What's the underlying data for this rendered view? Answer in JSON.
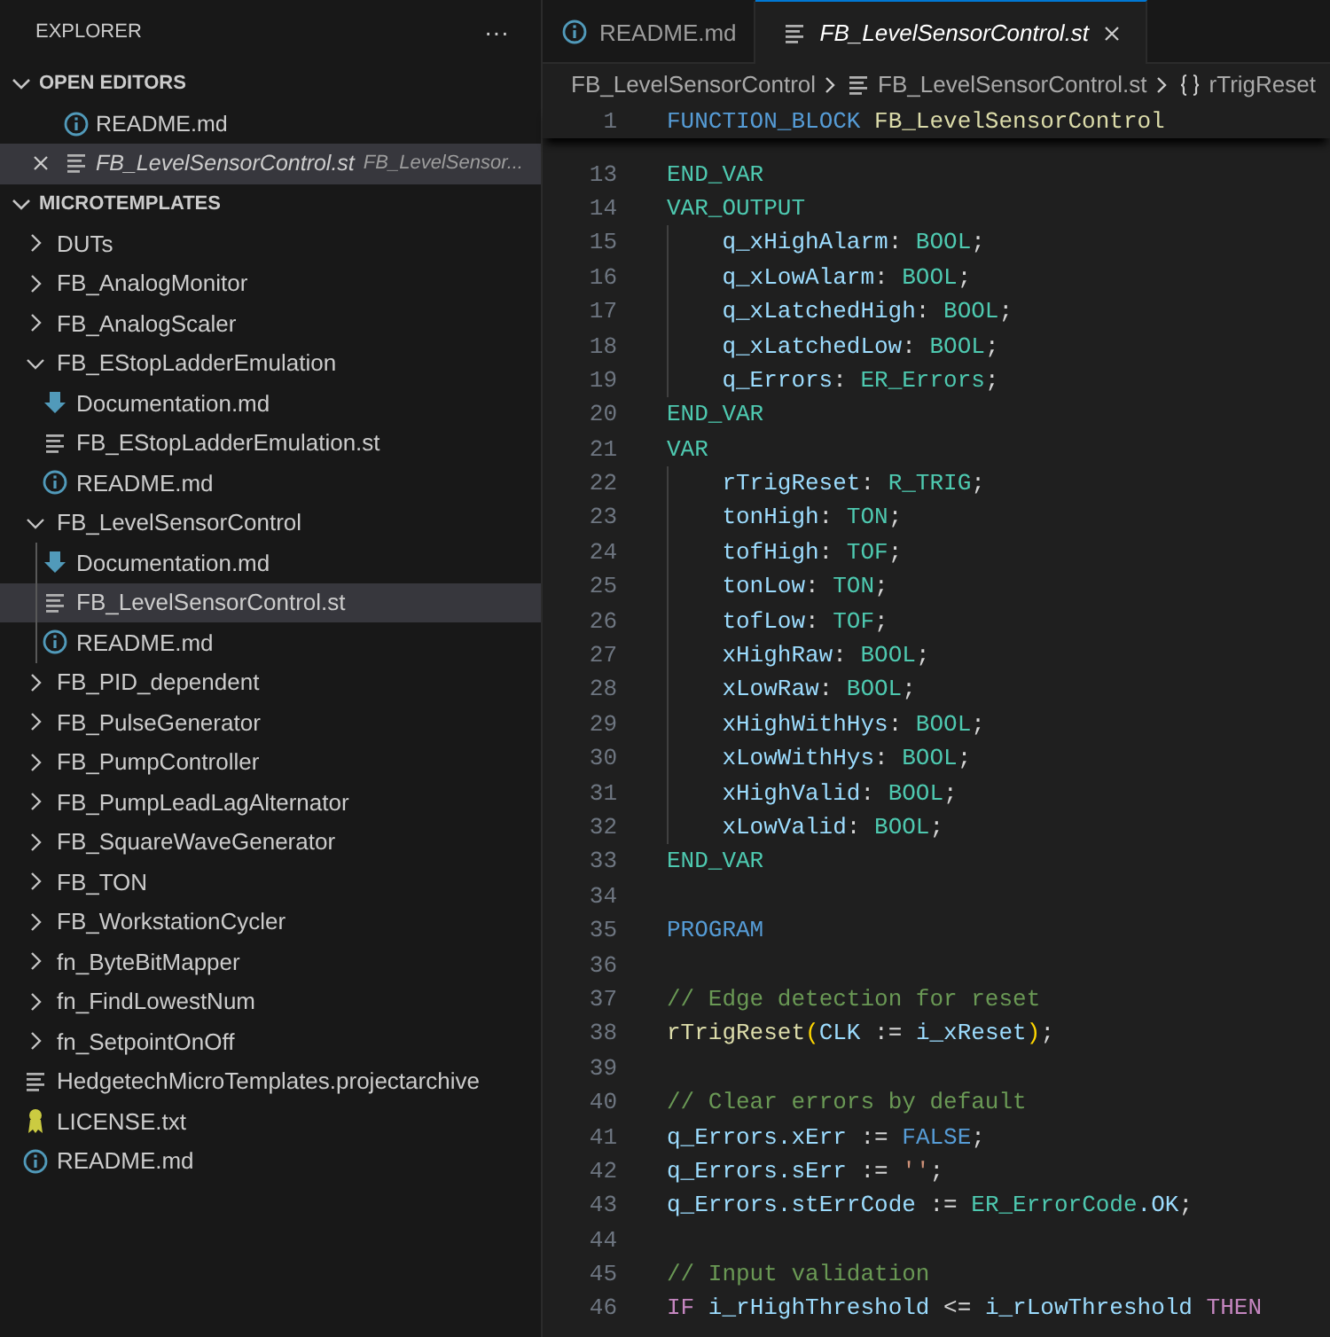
{
  "sidebar": {
    "title": "EXPLORER",
    "more": "···",
    "open_editors": {
      "title": "OPEN EDITORS",
      "expanded": true,
      "items": [
        {
          "label": "README.md",
          "kind": "info",
          "selected": false,
          "preview": false
        },
        {
          "label": "FB_LevelSensorControl.st",
          "kind": "source",
          "description": "FB_LevelSensor...",
          "selected": true,
          "preview": true
        }
      ]
    },
    "project": {
      "title": "MICROTEMPLATES",
      "expanded": true,
      "items": [
        {
          "label": "DUTs",
          "kind": "folder",
          "expanded": false,
          "selected": false
        },
        {
          "label": "FB_AnalogMonitor",
          "kind": "folder",
          "expanded": false,
          "selected": false
        },
        {
          "label": "FB_AnalogScaler",
          "kind": "folder",
          "expanded": false,
          "selected": false
        },
        {
          "label": "FB_EStopLadderEmulation",
          "kind": "folder",
          "expanded": true,
          "selected": false,
          "children": [
            {
              "label": "Documentation.md",
              "kind": "markdown",
              "selected": false
            },
            {
              "label": "FB_EStopLadderEmulation.st",
              "kind": "source",
              "selected": false
            },
            {
              "label": "README.md",
              "kind": "info",
              "selected": false
            }
          ]
        },
        {
          "label": "FB_LevelSensorControl",
          "kind": "folder",
          "expanded": true,
          "selected": false,
          "children": [
            {
              "label": "Documentation.md",
              "kind": "markdown",
              "selected": false
            },
            {
              "label": "FB_LevelSensorControl.st",
              "kind": "source",
              "selected": true
            },
            {
              "label": "README.md",
              "kind": "info",
              "selected": false
            }
          ]
        },
        {
          "label": "FB_PID_dependent",
          "kind": "folder",
          "expanded": false,
          "selected": false
        },
        {
          "label": "FB_PulseGenerator",
          "kind": "folder",
          "expanded": false,
          "selected": false
        },
        {
          "label": "FB_PumpController",
          "kind": "folder",
          "expanded": false,
          "selected": false
        },
        {
          "label": "FB_PumpLeadLagAlternator",
          "kind": "folder",
          "expanded": false,
          "selected": false
        },
        {
          "label": "FB_SquareWaveGenerator",
          "kind": "folder",
          "expanded": false,
          "selected": false
        },
        {
          "label": "FB_TON",
          "kind": "folder",
          "expanded": false,
          "selected": false
        },
        {
          "label": "FB_WorkstationCycler",
          "kind": "folder",
          "expanded": false,
          "selected": false
        },
        {
          "label": "fn_ByteBitMapper",
          "kind": "folder",
          "expanded": false,
          "selected": false
        },
        {
          "label": "fn_FindLowestNum",
          "kind": "folder",
          "expanded": false,
          "selected": false
        },
        {
          "label": "fn_SetpointOnOff",
          "kind": "folder",
          "expanded": false,
          "selected": false
        },
        {
          "label": "HedgetechMicroTemplates.projectarchive",
          "kind": "source",
          "selected": false
        },
        {
          "label": "LICENSE.txt",
          "kind": "license",
          "selected": false
        },
        {
          "label": "README.md",
          "kind": "info",
          "selected": false
        }
      ]
    }
  },
  "tabs": [
    {
      "label": "README.md",
      "kind": "info",
      "selected": false,
      "preview": false
    },
    {
      "label": "FB_LevelSensorControl.st",
      "kind": "source",
      "selected": true,
      "preview": true
    }
  ],
  "breadcrumbs": [
    {
      "label": "FB_LevelSensorControl",
      "kind": "folder"
    },
    {
      "label": "FB_LevelSensorControl.st",
      "kind": "source"
    },
    {
      "label": "rTrigReset",
      "kind": "symbol"
    }
  ],
  "sticky_lines": [
    {
      "number": "1",
      "tokens": [
        {
          "text": "FUNCTION_BLOCK",
          "kind": "keyword"
        },
        {
          "text": " FB_LevelSensorControl",
          "kind": "function"
        }
      ]
    }
  ],
  "code_lines": [
    {
      "number": "13",
      "indented": false,
      "tokens": [
        {
          "text": "END_VAR",
          "kind": "section"
        }
      ]
    },
    {
      "number": "14",
      "indented": false,
      "tokens": [
        {
          "text": "VAR_OUTPUT",
          "kind": "section"
        }
      ]
    },
    {
      "number": "15",
      "indented": true,
      "tokens": [
        {
          "text": "q_xHighAlarm",
          "kind": "variable"
        },
        {
          "text": ": ",
          "kind": "operator"
        },
        {
          "text": "BOOL",
          "kind": "type"
        },
        {
          "text": ";",
          "kind": "operator"
        }
      ]
    },
    {
      "number": "16",
      "indented": true,
      "tokens": [
        {
          "text": "q_xLowAlarm",
          "kind": "variable"
        },
        {
          "text": ": ",
          "kind": "operator"
        },
        {
          "text": "BOOL",
          "kind": "type"
        },
        {
          "text": ";",
          "kind": "operator"
        }
      ]
    },
    {
      "number": "17",
      "indented": true,
      "tokens": [
        {
          "text": "q_xLatchedHigh",
          "kind": "variable"
        },
        {
          "text": ": ",
          "kind": "operator"
        },
        {
          "text": "BOOL",
          "kind": "type"
        },
        {
          "text": ";",
          "kind": "operator"
        }
      ]
    },
    {
      "number": "18",
      "indented": true,
      "tokens": [
        {
          "text": "q_xLatchedLow",
          "kind": "variable"
        },
        {
          "text": ": ",
          "kind": "operator"
        },
        {
          "text": "BOOL",
          "kind": "type"
        },
        {
          "text": ";",
          "kind": "operator"
        }
      ]
    },
    {
      "number": "19",
      "indented": true,
      "tokens": [
        {
          "text": "q_Errors",
          "kind": "variable"
        },
        {
          "text": ": ",
          "kind": "operator"
        },
        {
          "text": "ER_Errors",
          "kind": "type"
        },
        {
          "text": ";",
          "kind": "operator"
        }
      ]
    },
    {
      "number": "20",
      "indented": false,
      "tokens": [
        {
          "text": "END_VAR",
          "kind": "section"
        }
      ]
    },
    {
      "number": "21",
      "indented": false,
      "tokens": [
        {
          "text": "VAR",
          "kind": "section"
        }
      ]
    },
    {
      "number": "22",
      "indented": true,
      "tokens": [
        {
          "text": "rTrigReset",
          "kind": "variable"
        },
        {
          "text": ": ",
          "kind": "operator"
        },
        {
          "text": "R_TRIG",
          "kind": "type"
        },
        {
          "text": ";",
          "kind": "operator"
        }
      ]
    },
    {
      "number": "23",
      "indented": true,
      "tokens": [
        {
          "text": "tonHigh",
          "kind": "variable"
        },
        {
          "text": ": ",
          "kind": "operator"
        },
        {
          "text": "TON",
          "kind": "type"
        },
        {
          "text": ";",
          "kind": "operator"
        }
      ]
    },
    {
      "number": "24",
      "indented": true,
      "tokens": [
        {
          "text": "tofHigh",
          "kind": "variable"
        },
        {
          "text": ": ",
          "kind": "operator"
        },
        {
          "text": "TOF",
          "kind": "type"
        },
        {
          "text": ";",
          "kind": "operator"
        }
      ]
    },
    {
      "number": "25",
      "indented": true,
      "tokens": [
        {
          "text": "tonLow",
          "kind": "variable"
        },
        {
          "text": ": ",
          "kind": "operator"
        },
        {
          "text": "TON",
          "kind": "type"
        },
        {
          "text": ";",
          "kind": "operator"
        }
      ]
    },
    {
      "number": "26",
      "indented": true,
      "tokens": [
        {
          "text": "tofLow",
          "kind": "variable"
        },
        {
          "text": ": ",
          "kind": "operator"
        },
        {
          "text": "TOF",
          "kind": "type"
        },
        {
          "text": ";",
          "kind": "operator"
        }
      ]
    },
    {
      "number": "27",
      "indented": true,
      "tokens": [
        {
          "text": "xHighRaw",
          "kind": "variable"
        },
        {
          "text": ": ",
          "kind": "operator"
        },
        {
          "text": "BOOL",
          "kind": "type"
        },
        {
          "text": ";",
          "kind": "operator"
        }
      ]
    },
    {
      "number": "28",
      "indented": true,
      "tokens": [
        {
          "text": "xLowRaw",
          "kind": "variable"
        },
        {
          "text": ": ",
          "kind": "operator"
        },
        {
          "text": "BOOL",
          "kind": "type"
        },
        {
          "text": ";",
          "kind": "operator"
        }
      ]
    },
    {
      "number": "29",
      "indented": true,
      "tokens": [
        {
          "text": "xHighWithHys",
          "kind": "variable"
        },
        {
          "text": ": ",
          "kind": "operator"
        },
        {
          "text": "BOOL",
          "kind": "type"
        },
        {
          "text": ";",
          "kind": "operator"
        }
      ]
    },
    {
      "number": "30",
      "indented": true,
      "tokens": [
        {
          "text": "xLowWithHys",
          "kind": "variable"
        },
        {
          "text": ": ",
          "kind": "operator"
        },
        {
          "text": "BOOL",
          "kind": "type"
        },
        {
          "text": ";",
          "kind": "operator"
        }
      ]
    },
    {
      "number": "31",
      "indented": true,
      "tokens": [
        {
          "text": "xHighValid",
          "kind": "variable"
        },
        {
          "text": ": ",
          "kind": "operator"
        },
        {
          "text": "BOOL",
          "kind": "type"
        },
        {
          "text": ";",
          "kind": "operator"
        }
      ]
    },
    {
      "number": "32",
      "indented": true,
      "tokens": [
        {
          "text": "xLowValid",
          "kind": "variable"
        },
        {
          "text": ": ",
          "kind": "operator"
        },
        {
          "text": "BOOL",
          "kind": "type"
        },
        {
          "text": ";",
          "kind": "operator"
        }
      ]
    },
    {
      "number": "33",
      "indented": false,
      "tokens": [
        {
          "text": "END_VAR",
          "kind": "section"
        }
      ]
    },
    {
      "number": "34",
      "indented": false
    },
    {
      "number": "35",
      "indented": false,
      "tokens": [
        {
          "text": "PROGRAM",
          "kind": "keyword"
        }
      ]
    },
    {
      "number": "36",
      "indented": false
    },
    {
      "number": "37",
      "indented": false,
      "tokens": [
        {
          "text": "// Edge detection for reset",
          "kind": "comment"
        }
      ]
    },
    {
      "number": "38",
      "indented": false,
      "tokens": [
        {
          "text": "rTrigReset",
          "kind": "function"
        },
        {
          "text": "(",
          "kind": "bracket"
        },
        {
          "text": "CLK",
          "kind": "variable"
        },
        {
          "text": " := ",
          "kind": "operator"
        },
        {
          "text": "i_xReset",
          "kind": "variable"
        },
        {
          "text": ")",
          "kind": "bracket"
        },
        {
          "text": ";",
          "kind": "operator"
        }
      ]
    },
    {
      "number": "39",
      "indented": false
    },
    {
      "number": "40",
      "indented": false,
      "tokens": [
        {
          "text": "// Clear errors by default",
          "kind": "comment"
        }
      ]
    },
    {
      "number": "41",
      "indented": false,
      "tokens": [
        {
          "text": "q_Errors.xErr",
          "kind": "variable"
        },
        {
          "text": " := ",
          "kind": "operator"
        },
        {
          "text": "FALSE",
          "kind": "keyword"
        },
        {
          "text": ";",
          "kind": "operator"
        }
      ]
    },
    {
      "number": "42",
      "indented": false,
      "tokens": [
        {
          "text": "q_Errors.sErr",
          "kind": "variable"
        },
        {
          "text": " := ",
          "kind": "operator"
        },
        {
          "text": "''",
          "kind": "string"
        },
        {
          "text": ";",
          "kind": "operator"
        }
      ]
    },
    {
      "number": "43",
      "indented": false,
      "tokens": [
        {
          "text": "q_Errors.stErrCode",
          "kind": "variable"
        },
        {
          "text": " := ",
          "kind": "operator"
        },
        {
          "text": "ER_ErrorCode",
          "kind": "type"
        },
        {
          "text": ".OK",
          "kind": "variable"
        },
        {
          "text": ";",
          "kind": "operator"
        }
      ]
    },
    {
      "number": "44",
      "indented": false
    },
    {
      "number": "45",
      "indented": false,
      "tokens": [
        {
          "text": "// Input validation",
          "kind": "comment"
        }
      ]
    },
    {
      "number": "46",
      "indented": false,
      "tokens": [
        {
          "text": "IF",
          "kind": "control"
        },
        {
          "text": " i_rHighThreshold",
          "kind": "variable"
        },
        {
          "text": " <= ",
          "kind": "operator"
        },
        {
          "text": "i_rLowThreshold",
          "kind": "variable"
        },
        {
          "text": " THEN",
          "kind": "control"
        }
      ]
    }
  ]
}
